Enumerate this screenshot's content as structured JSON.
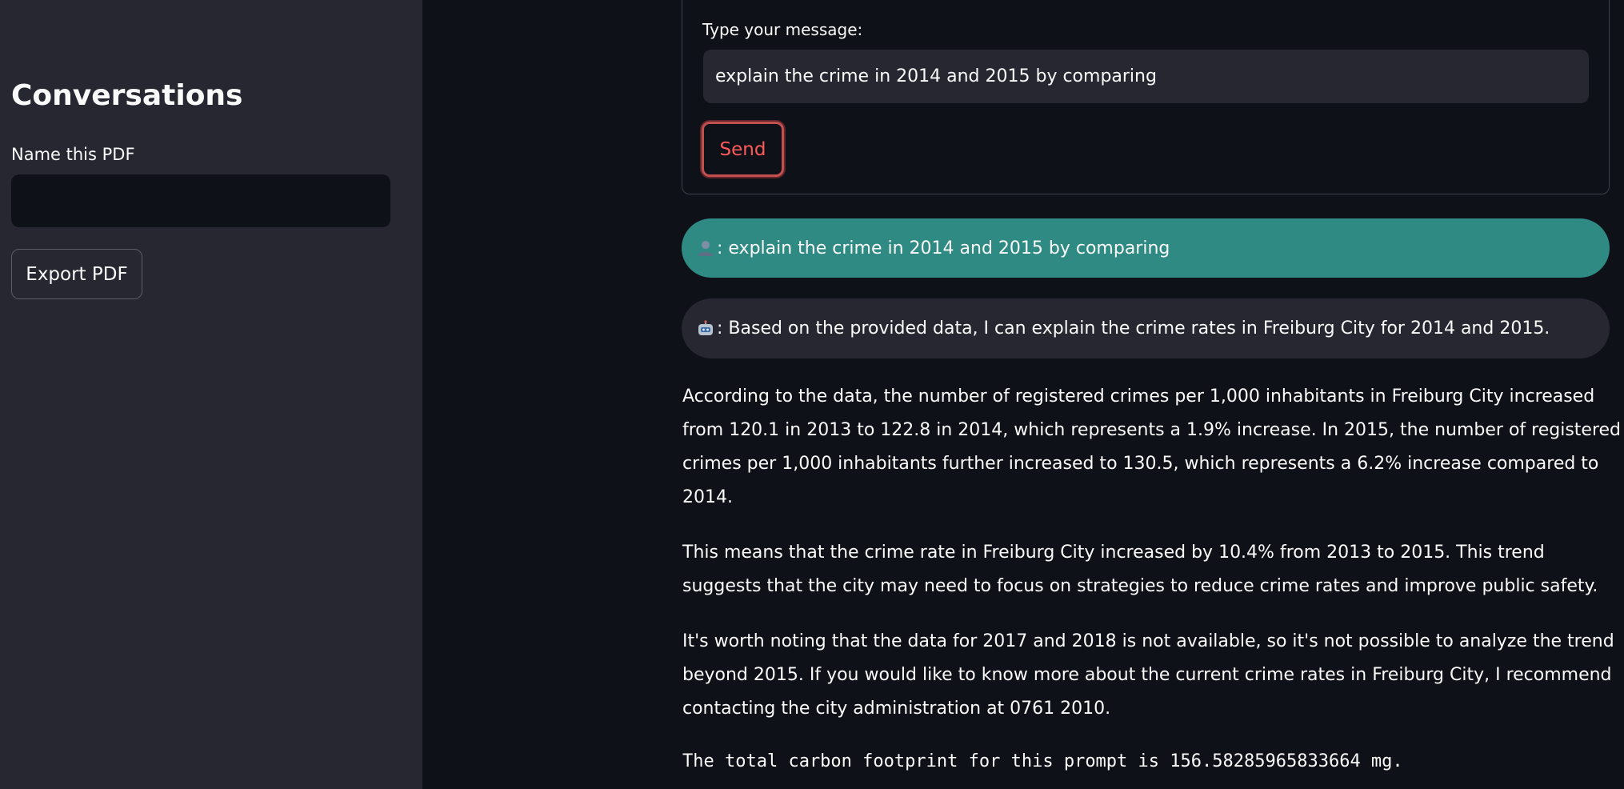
{
  "sidebar": {
    "title": "Conversations",
    "name_label": "Name this PDF",
    "name_value": "",
    "export_label": "Export PDF"
  },
  "form": {
    "label": "Type your message:",
    "input_value": "explain the crime in 2014 and 2015 by comparing",
    "send_label": "Send"
  },
  "chat": {
    "user_icon": "user-avatar-icon",
    "user_message": ": explain the crime in 2014 and 2015 by comparing",
    "bot_icon": "robot-icon",
    "bot_message": ": Based on the provided data, I can explain the crime rates in Freiburg City for 2014 and 2015."
  },
  "response": {
    "paragraphs": [
      "According to the data, the number of registered crimes per 1,000 inhabitants in Freiburg City increased from 120.1 in 2013 to 122.8 in 2014, which represents a 1.9% increase. In 2015, the number of registered crimes per 1,000 inhabitants further increased to 130.5, which represents a 6.2% increase compared to 2014.",
      "This means that the crime rate in Freiburg City increased by 10.4% from 2013 to 2015. This trend suggests that the city may need to focus on strategies to reduce crime rates and improve public safety.",
      "It's worth noting that the data for 2017 and 2018 is not available, so it's not possible to analyze the trend beyond 2015. If you would like to know more about the current crime rates in Freiburg City, I recommend contacting the city administration at 0761 2010."
    ],
    "carbon": "The total carbon footprint for this prompt is 156.58285965833664 mg."
  },
  "colors": {
    "sidebar_bg": "#262730",
    "main_bg": "#0e1117",
    "user_bubble": "#2e8a83",
    "bot_bubble": "#262730",
    "send_accent": "#ff4b4b"
  }
}
